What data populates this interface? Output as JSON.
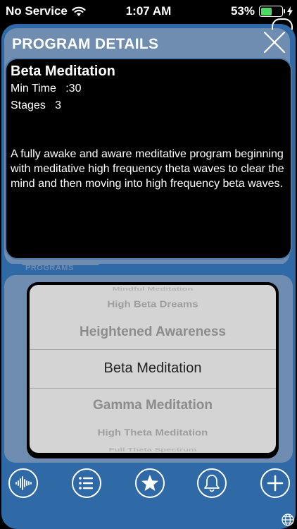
{
  "status_bar": {
    "carrier": "No Service",
    "time": "1:07 AM",
    "battery_percent": "53%",
    "battery_level": 0.53
  },
  "header": {
    "title": "PROGRAM DETAILS"
  },
  "program": {
    "name": "Beta Meditation",
    "min_time": "Min Time   :30",
    "stages": "Stages   3",
    "description": "A fully awake and aware meditative program beginning with meditative high frequency theta waves to clear the mind and then moving into high frequency beta waves."
  },
  "programs_section": {
    "label": "PROGRAMS"
  },
  "picker": {
    "items": [
      "Mindful Meditation",
      "High Beta Dreams",
      "Heightened Awareness",
      "Beta Meditation",
      "Gamma Meditation",
      "High Theta Meditation",
      "Full Theta Spectrum"
    ],
    "selected": "Beta Meditation"
  },
  "toolbar": {
    "icons": [
      "waveform-icon",
      "list-icon",
      "star-icon",
      "bell-icon",
      "plus-icon"
    ]
  },
  "colors": {
    "frame_blue": "#2f6aa6",
    "panel_slate": "#6f8db0",
    "picker_bg": "#d4d4d4",
    "battery_green": "#4cd964"
  }
}
